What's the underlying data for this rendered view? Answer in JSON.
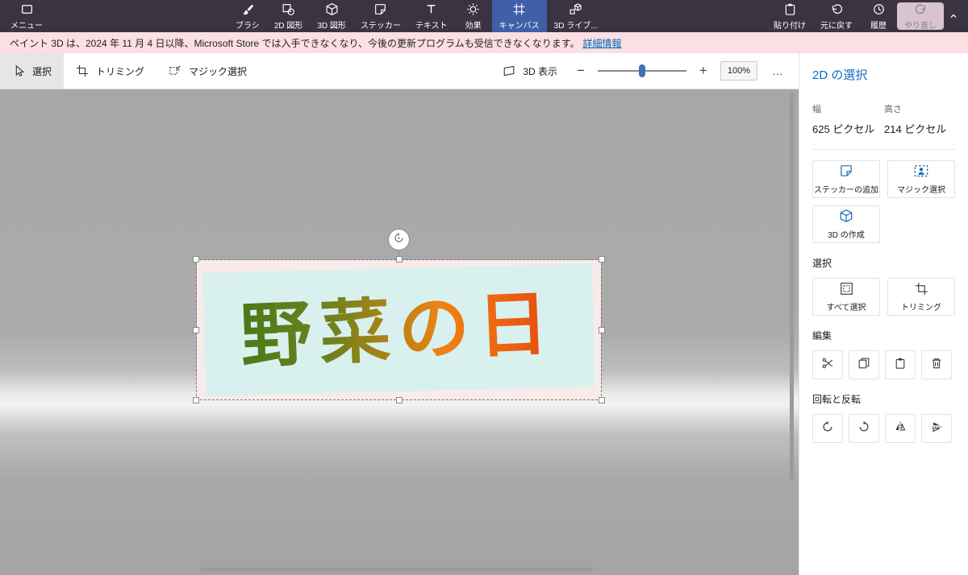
{
  "colors": {
    "topbar_bg": "#3a3442",
    "selected_tool_bg": "#3f5fa9",
    "banner_bg": "#fbdfe3",
    "accent_blue": "#0f6cbd",
    "sticker_bg": "#d8f1ef",
    "sticker_text_gradient": [
      "#4d7a1a",
      "#72821b",
      "#ef8213",
      "#e84c0e"
    ]
  },
  "topbar": {
    "menu_label": "メニュー",
    "tools": [
      {
        "label": "ブラシ"
      },
      {
        "label": "2D 図形"
      },
      {
        "label": "3D 図形"
      },
      {
        "label": "ステッカー"
      },
      {
        "label": "テキスト"
      },
      {
        "label": "効果"
      },
      {
        "label": "キャンバス"
      },
      {
        "label": "3D ライブ..."
      }
    ],
    "actions": [
      {
        "label": "貼り付け"
      },
      {
        "label": "元に戻す"
      },
      {
        "label": "履歴"
      },
      {
        "label": "やり直し"
      }
    ]
  },
  "banner": {
    "message": "ペイント 3D は、2024 年 11 月 4 日以降、Microsoft Store では入手できなくなり、今後の更新プログラムも受信できなくなります。",
    "link_label": "詳細情報"
  },
  "toolbar": {
    "select_label": "選択",
    "crop_label": "トリミング",
    "magic_select_label": "マジック選択",
    "view_3d_label": "3D 表示",
    "zoom_out_label": "−",
    "zoom_in_label": "+",
    "zoom_value": "100%",
    "more_label": "…"
  },
  "canvas": {
    "sticker_text": "野菜の日"
  },
  "panel": {
    "title": "2D の選択",
    "width_label": "幅",
    "width_value": "625 ピクセル",
    "height_label": "高さ",
    "height_value": "214 ピクセル",
    "add_sticker_label": "ステッカーの追加",
    "magic_select_label": "マジック選択",
    "make_3d_label": "3D の作成",
    "selection_section": "選択",
    "select_all_label": "すべて選択",
    "crop_label": "トリミング",
    "edit_section": "編集",
    "rotate_section": "回転と反転"
  }
}
